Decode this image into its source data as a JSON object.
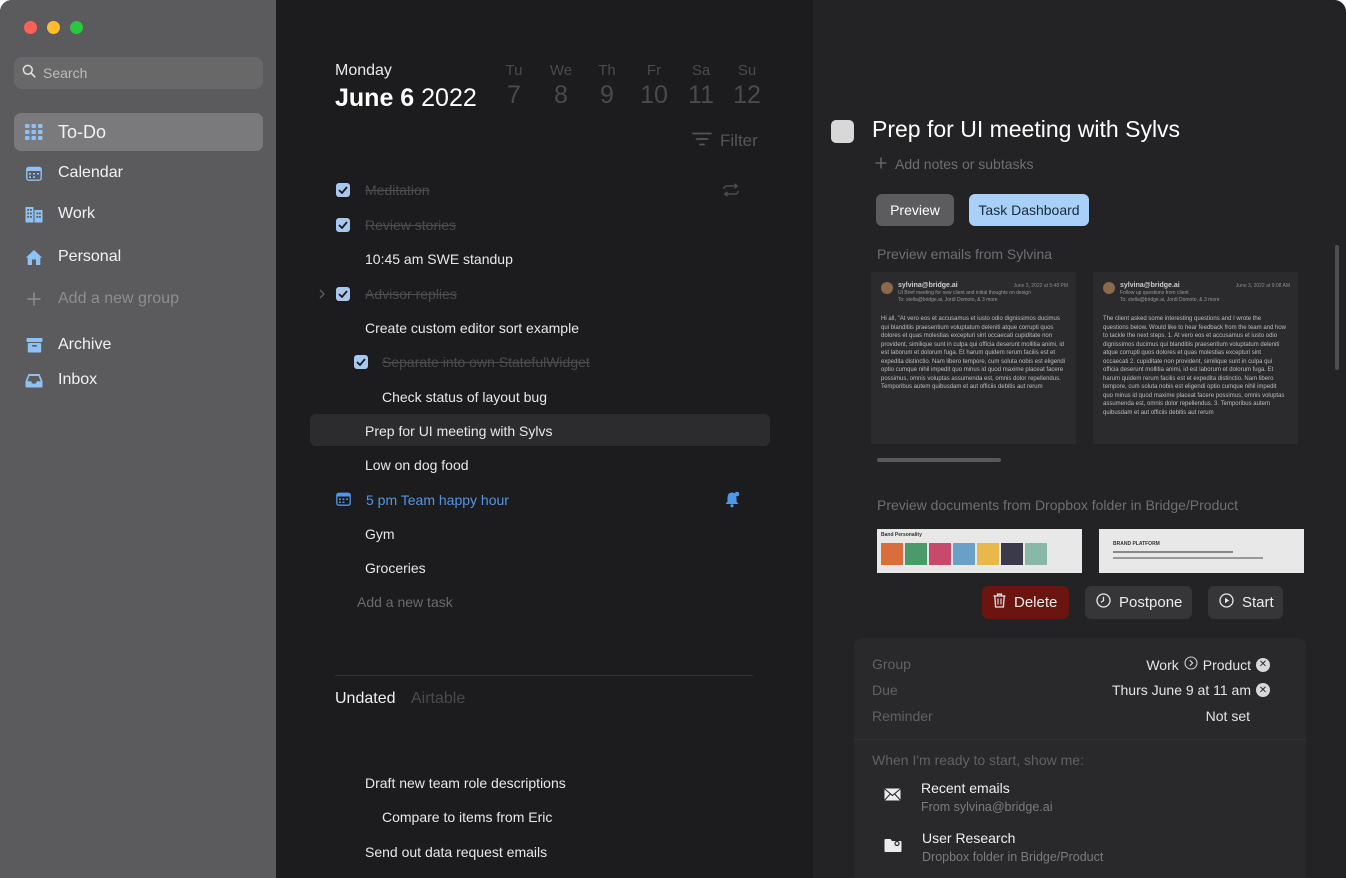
{
  "sidebar": {
    "search_placeholder": "Search",
    "items": [
      {
        "label": "To-Do",
        "icon": "grid-icon"
      },
      {
        "label": "Calendar",
        "icon": "calendar-icon"
      },
      {
        "label": "Work",
        "icon": "building-icon"
      },
      {
        "label": "Personal",
        "icon": "house-icon"
      },
      {
        "label": "Add a new group",
        "icon": "plus-icon"
      },
      {
        "label": "Archive",
        "icon": "archive-icon"
      },
      {
        "label": "Inbox",
        "icon": "inbox-icon"
      }
    ]
  },
  "header": {
    "day_name": "Monday",
    "date_bold": "June 6",
    "year": "2022",
    "week": [
      {
        "wd": "Tu",
        "n": "7"
      },
      {
        "wd": "We",
        "n": "8"
      },
      {
        "wd": "Th",
        "n": "9"
      },
      {
        "wd": "Fr",
        "n": "10"
      },
      {
        "wd": "Sa",
        "n": "11"
      },
      {
        "wd": "Su",
        "n": "12"
      }
    ],
    "filter_label": "Filter"
  },
  "tasks": [
    {
      "text": "Meditation"
    },
    {
      "text": "Review stories"
    },
    {
      "text": "10:45 am SWE standup"
    },
    {
      "text": "Advisor replies"
    },
    {
      "text": "Create custom editor sort example"
    },
    {
      "text": "Separate into own StatefulWidget"
    },
    {
      "text": "Check status of layout bug"
    },
    {
      "text": "Prep for UI meeting with Sylvs"
    },
    {
      "text": "Low on dog food"
    },
    {
      "text": "5 pm Team happy hour"
    },
    {
      "text": "Gym"
    },
    {
      "text": "Groceries"
    },
    {
      "text": "Add a new task"
    }
  ],
  "tabs": {
    "undated": "Undated",
    "airtable": "Airtable"
  },
  "undated_tasks": [
    {
      "text": "Draft new team role descriptions"
    },
    {
      "text": "Compare to items from Eric"
    },
    {
      "text": "Send out data request emails"
    }
  ],
  "detail": {
    "title": "Prep for UI meeting with Sylvs",
    "add_notes": "Add notes or subtasks",
    "btn_preview": "Preview",
    "btn_dashboard": "Task Dashboard",
    "emails_label": "Preview emails from Sylvina",
    "docs_label": "Preview documents from Dropbox folder in Bridge/Product",
    "emails": [
      {
        "from": "sylvina@bridge.ai",
        "date": "June 3, 2022 at 5:48 PM",
        "subject": "UI Brief meeting for new client and initial thoughts on design",
        "to": "To: stella@bridge.ai, Jordi Domoto, & 3 more",
        "body": "Hi all, \"At vero eos et accusamus et iusto odio dignissimos ducimus qui blanditiis praesentium voluptatum deleniti atque corrupti quos dolores et quas molestias excepturi sint occaecati cupiditate non provident, similique sunt in culpa qui officia deserunt mollitia animi, id est laborum et dolorum fuga. Et harum quidem rerum facilis est et expedita distinctio. Nam libero tempore, cum soluta nobis est eligendi optio cumque nihil impedit quo minus id quod maxime placeat facere possimus, omnis voluptas assumenda est, omnis dolor repellendus. Temporibus autem quibusdam et aut officiis debitis aut rerum"
      },
      {
        "from": "sylvina@bridge.ai",
        "date": "June 3, 2022 at 9:08 AM",
        "subject": "Follow up questions from client",
        "to": "To: stella@bridge.ai, Jordi Domoto, & 3 more",
        "body": "The client asked some interesting questions and I wrote the questions below. Would like to hear feedback from the team and how to tackle the next steps. 1. At vero eos et accusamus et iusto odio dignissimos ducimus qui blanditiis praesentium voluptatum deleniti atque corrupti quos dolores et quas molestias excepturi sint occaecati 2. cupiditate non provident, similique sunt in culpa qui officia deserunt mollitia animi, id est laborum et dolorum fuga. Et harum quidem rerum facilis est et expedita distinctio. Nam libero tempore, cum soluta nobis est eligendi optio cumque nihil impedit quo minus id quod maxime placeat facere possimus, omnis voluptas assumenda est, omnis dolor repellendus. 3. Temporibus autem quibusdam et aut officiis debitis aut rerum"
      }
    ],
    "docs": [
      {
        "title": "Band Personality"
      },
      {
        "title": "BRAND PLATFORM"
      }
    ],
    "actions": {
      "delete": "Delete",
      "postpone": "Postpone",
      "start": "Start"
    },
    "meta": {
      "group_key": "Group",
      "group_from": "Work",
      "group_to": "Product",
      "due_key": "Due",
      "due_val": "Thurs June 9 at 11 am",
      "reminder_key": "Reminder",
      "reminder_val": "Not set"
    },
    "ready_label": "When I'm ready to start, show me:",
    "resources": [
      {
        "title": "Recent emails",
        "sub": "From sylvina@bridge.ai",
        "icon": "envelope-icon"
      },
      {
        "title": "User Research",
        "sub": "Dropbox folder in Bridge/Product",
        "icon": "folder-icon"
      }
    ]
  },
  "colors": {
    "sidebar_bg": "#5b5b5d",
    "middle_bg": "#1c1c1e",
    "right_bg": "#232325",
    "accent_blue": "#4f97e8",
    "checkbox": "#a8c8f0",
    "delete_bg": "#6a1510",
    "dashboard_btn": "#a8d0f8"
  }
}
